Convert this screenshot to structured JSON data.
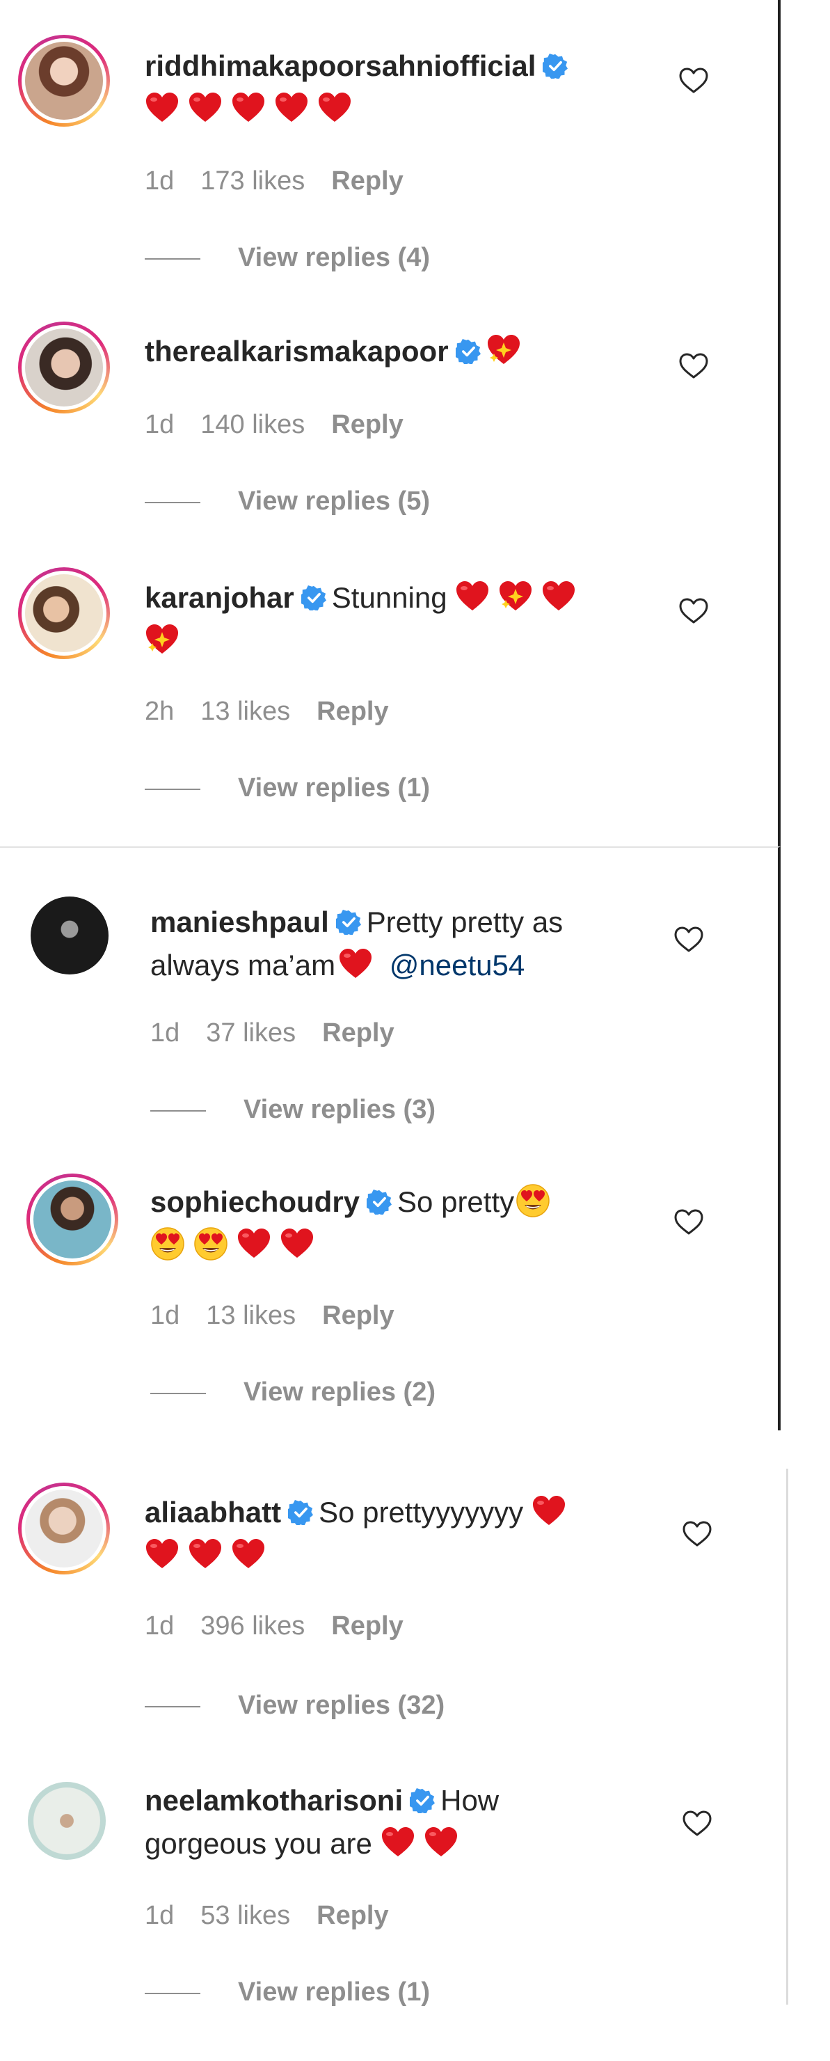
{
  "colors": {
    "text": "#262626",
    "secondary": "#8e8e8e",
    "verified": "#3897f0",
    "mention": "#00376b",
    "heart_emoji": "#e0141e"
  },
  "comments": [
    {
      "username": "riddhimakapoorsahniofficial",
      "text": "",
      "emoji_line1": [
        "red-heart",
        "red-heart",
        "red-heart",
        "red-heart",
        "red-heart"
      ],
      "time": "1d",
      "likes": "173 likes",
      "reply": "Reply",
      "view_replies": "View replies (4)"
    },
    {
      "username": "therealkarismakapoor",
      "text": "",
      "emoji_line1": [
        "sparkling-heart"
      ],
      "time": "1d",
      "likes": "140 likes",
      "reply": "Reply",
      "view_replies": "View replies (5)"
    },
    {
      "username": "karanjohar",
      "text": "Stunning",
      "emoji_line1": [
        "red-heart",
        "sparkling-heart",
        "red-heart"
      ],
      "emoji_line2": [
        "sparkling-heart"
      ],
      "time": "2h",
      "likes": "13 likes",
      "reply": "Reply",
      "view_replies": "View replies (1)"
    },
    {
      "username": "manieshpaul",
      "text_line1": "Pretty pretty as",
      "text_line2": "always ma’am",
      "mention": "@neetu54",
      "time": "1d",
      "likes": "37 likes",
      "reply": "Reply",
      "view_replies": "View replies (3)"
    },
    {
      "username": "sophiechoudry",
      "text": "So pretty",
      "emoji_line2": [
        "heart-eyes",
        "heart-eyes",
        "red-heart",
        "red-heart"
      ],
      "time": "1d",
      "likes": "13 likes",
      "reply": "Reply",
      "view_replies": "View replies (2)"
    },
    {
      "username": "aliaabhatt",
      "text": "So prettyyyyyyy",
      "emoji_line2": [
        "red-heart",
        "red-heart",
        "red-heart"
      ],
      "time": "1d",
      "likes": "396 likes",
      "reply": "Reply",
      "view_replies": "View replies (32)"
    },
    {
      "username": "neelamkotharisoni",
      "text_line1": "How",
      "text_line2": "gorgeous you are",
      "time": "1d",
      "likes": "53 likes",
      "reply": "Reply",
      "view_replies": "View replies (1)"
    }
  ]
}
